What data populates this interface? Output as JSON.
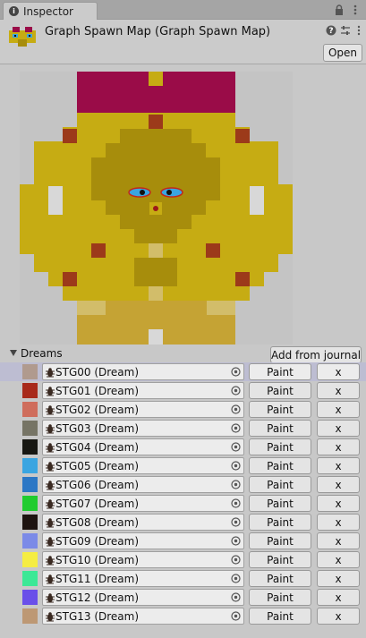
{
  "tab": {
    "title": "Inspector",
    "icon": "info-icon"
  },
  "header": {
    "title": "Graph Spawn Map (Graph Spawn Map)",
    "open_label": "Open",
    "icons": [
      "asset-icon",
      "help-icon",
      "preset-icon",
      "more-icon"
    ]
  },
  "dreams": {
    "label": "Dreams",
    "add_from_journal_label": "Add from journal",
    "paint_label": "Paint",
    "remove_label": "x",
    "items": [
      {
        "name": "STG00 (Dream)",
        "color": "#b09a8e",
        "selected": true
      },
      {
        "name": "STG01 (Dream)",
        "color": "#a82a1b"
      },
      {
        "name": "STG02 (Dream)",
        "color": "#cf6d5c"
      },
      {
        "name": "STG03 (Dream)",
        "color": "#767465"
      },
      {
        "name": "STG04 (Dream)",
        "color": "#171712"
      },
      {
        "name": "STG05 (Dream)",
        "color": "#3aa5e1"
      },
      {
        "name": "STG06 (Dream)",
        "color": "#2c77c5"
      },
      {
        "name": "STG07 (Dream)",
        "color": "#20cc2f"
      },
      {
        "name": "STG08 (Dream)",
        "color": "#1d1310"
      },
      {
        "name": "STG09 (Dream)",
        "color": "#7b8ae7"
      },
      {
        "name": "STG10 (Dream)",
        "color": "#f5ed43"
      },
      {
        "name": "STG11 (Dream)",
        "color": "#3be896"
      },
      {
        "name": "STG12 (Dream)",
        "color": "#6a4fe9"
      },
      {
        "name": "STG13 (Dream)",
        "color": "#bd9874"
      }
    ]
  },
  "map_colors": {
    "background": "#c4c4c4",
    "gold": "#c6ac13",
    "gold_dark": "#a78d0c",
    "tan": "#c5a334",
    "magenta": "#9a0c48",
    "red_tile": "#9c3a1a",
    "eye_blue": "#3aa5e1",
    "eye_red": "#c3261a"
  }
}
